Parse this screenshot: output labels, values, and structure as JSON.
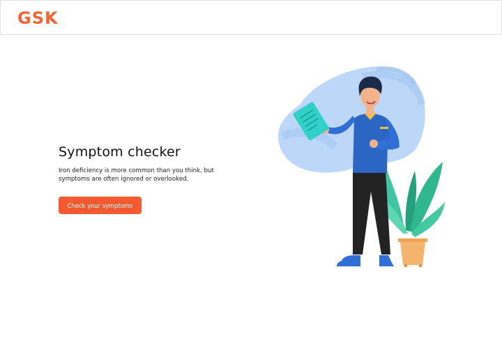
{
  "header": {
    "logo_text": "GSK"
  },
  "hero": {
    "title": "Symptom checker",
    "description": "Iron deficiency is more common than you think, but symptoms are often ignored or overlooked.",
    "button_label": "Check your symptoms"
  },
  "colors": {
    "brand": "#f36633",
    "button": "#f4592f",
    "blob": "#bcd7f7"
  },
  "illustration": {
    "icon": "doctor-with-clipboard-and-plant"
  }
}
